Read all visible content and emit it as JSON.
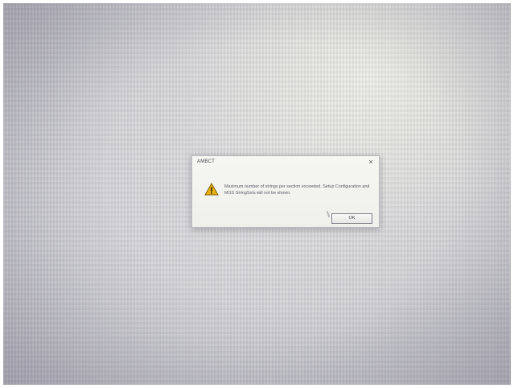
{
  "dialog": {
    "title": "AMBCT",
    "close_glyph": "×",
    "icon": "warning-icon",
    "message": "Maximum number of strings per section exceeded. Setup Configuration and MGS StringSets will not be shown.",
    "ok_label": "OK"
  },
  "colors": {
    "warning_fill": "#e8b10f",
    "warning_outline": "#7a5a00",
    "dialog_background": "#f3f3ef"
  }
}
